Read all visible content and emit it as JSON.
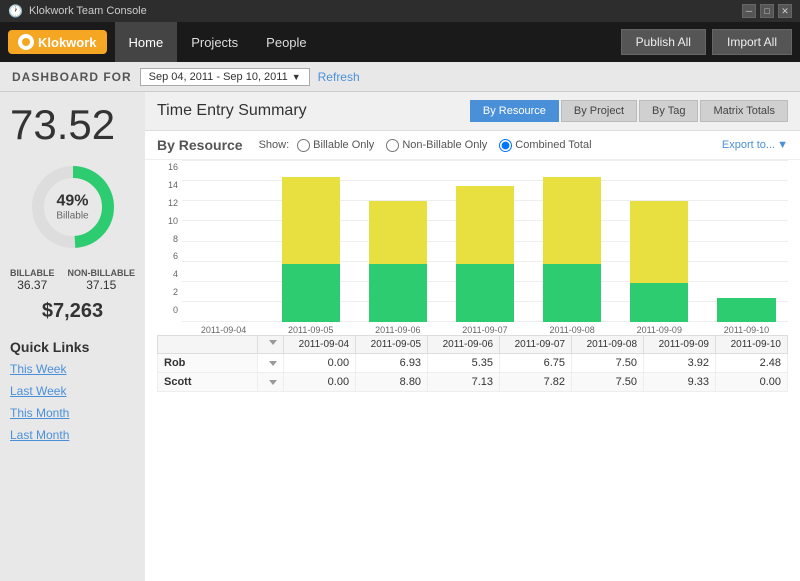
{
  "titleBar": {
    "title": "Klokwork Team Console",
    "controls": [
      "minimize",
      "maximize",
      "close"
    ]
  },
  "nav": {
    "logo": "Klokwork",
    "items": [
      {
        "label": "Home",
        "active": true
      },
      {
        "label": "Projects",
        "active": false
      },
      {
        "label": "People",
        "active": false
      }
    ],
    "buttons": [
      {
        "label": "Publish All"
      },
      {
        "label": "Import All"
      }
    ]
  },
  "dashboard": {
    "title": "DASHBOARD FOR",
    "dateRange": "Sep 04, 2011 - Sep 10, 2011",
    "refresh": "Refresh"
  },
  "sidebar": {
    "totalHours": "73.52",
    "donut": {
      "percentage": "49%",
      "label": "Billable",
      "billableVal": "36.37",
      "nonBillableVal": "37.15",
      "billableLabel": "BILLABLE",
      "nonBillableLabel": "NON-BILLABLE"
    },
    "revenue": "$7,263",
    "quickLinks": {
      "title": "Quick Links",
      "links": [
        {
          "label": "This Week"
        },
        {
          "label": "Last Week"
        },
        {
          "label": "This Month"
        },
        {
          "label": "Last Month"
        }
      ]
    }
  },
  "summary": {
    "title": "Time Entry Summary",
    "tabs": [
      {
        "label": "By Resource",
        "active": true
      },
      {
        "label": "By Project",
        "active": false
      },
      {
        "label": "By Tag",
        "active": false
      },
      {
        "label": "Matrix Totals",
        "active": false
      }
    ],
    "exportLabel": "Export to...",
    "byResourceTitle": "By Resource",
    "show": {
      "label": "Show:",
      "options": [
        {
          "label": "Billable Only",
          "checked": false
        },
        {
          "label": "Non-Billable Only",
          "checked": false
        },
        {
          "label": "Combined Total",
          "checked": true
        }
      ]
    },
    "chart": {
      "yLabels": [
        "16",
        "14",
        "12",
        "10",
        "8",
        "6",
        "4",
        "2",
        "0"
      ],
      "bars": [
        {
          "date": "2011-09-04",
          "green": 0,
          "yellow": 0
        },
        {
          "date": "2011-09-05",
          "green": 6,
          "yellow": 9
        },
        {
          "date": "2011-09-06",
          "green": 6,
          "yellow": 6.5
        },
        {
          "date": "2011-09-07",
          "green": 6,
          "yellow": 8
        },
        {
          "date": "2011-09-08",
          "green": 6,
          "yellow": 9
        },
        {
          "date": "2011-09-09",
          "green": 4,
          "yellow": 8.5
        },
        {
          "date": "2011-09-10",
          "green": 2.5,
          "yellow": 0
        }
      ],
      "maxVal": 16
    },
    "table": {
      "headers": [
        "",
        "",
        "2011-09-04",
        "2011-09-05",
        "2011-09-06",
        "2011-09-07",
        "2011-09-08",
        "2011-09-09",
        "2011-09-10"
      ],
      "rows": [
        {
          "name": "Rob",
          "cols": [
            "0.00",
            "6.93",
            "5.35",
            "6.75",
            "7.50",
            "3.92",
            "2.48"
          ]
        },
        {
          "name": "Scott",
          "cols": [
            "0.00",
            "8.80",
            "7.13",
            "7.82",
            "7.50",
            "9.33",
            "0.00"
          ]
        }
      ]
    }
  }
}
